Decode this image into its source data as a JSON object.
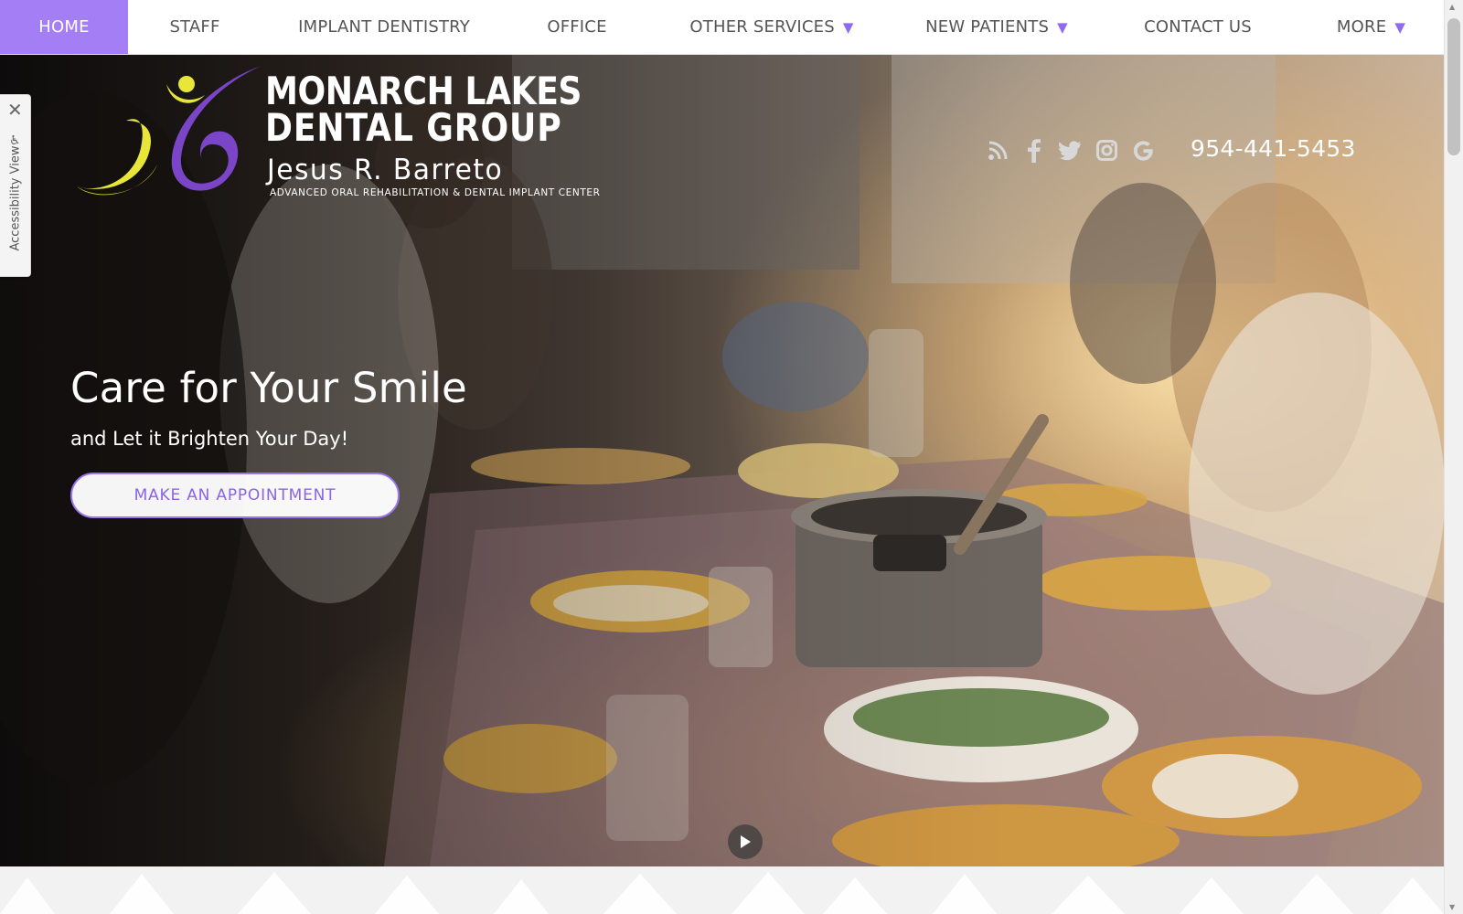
{
  "nav": {
    "items": [
      {
        "label": "HOME",
        "active": true,
        "dropdown": false
      },
      {
        "label": "STAFF",
        "active": false,
        "dropdown": false
      },
      {
        "label": "IMPLANT DENTISTRY",
        "active": false,
        "dropdown": false
      },
      {
        "label": "OFFICE",
        "active": false,
        "dropdown": false
      },
      {
        "label": "OTHER SERVICES",
        "active": false,
        "dropdown": true
      },
      {
        "label": "NEW PATIENTS",
        "active": false,
        "dropdown": true
      },
      {
        "label": "CONTACT US",
        "active": false,
        "dropdown": false
      },
      {
        "label": "MORE",
        "active": false,
        "dropdown": true
      }
    ],
    "caret": "▼"
  },
  "logo": {
    "line1": "MONARCH LAKES",
    "line2": "DENTAL GROUP",
    "name": "Jesus R. Barreto",
    "tagline": "ADVANCED ORAL REHABILITATION & DENTAL IMPLANT CENTER"
  },
  "social": [
    "rss-icon",
    "facebook-icon",
    "twitter-icon",
    "instagram-icon",
    "google-icon"
  ],
  "phone": "954-441-5453",
  "accessibility": {
    "label": "Accessibility View",
    "close": "✕",
    "icon": "wheelchair-icon"
  },
  "hero": {
    "headline": "Care for Your Smile",
    "subhead": "and Let it Brighten Your Day!",
    "cta": "MAKE AN APPOINTMENT"
  },
  "colors": {
    "accent": "#a47ef5",
    "accent_text": "#8a63e9",
    "logo_yellow": "#e9e63a",
    "logo_purple": "#7b45c8"
  }
}
